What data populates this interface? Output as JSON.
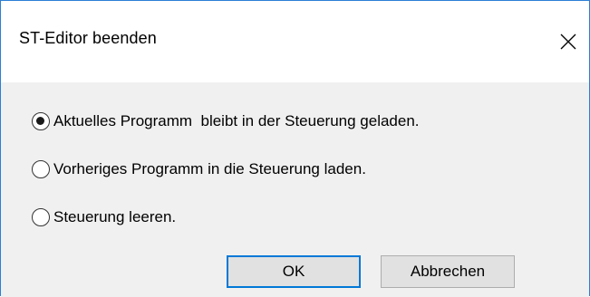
{
  "dialog": {
    "title": "ST-Editor beenden",
    "close_icon": "close-icon"
  },
  "options": [
    {
      "label": "Aktuelles Programm  bleibt in der Steuerung geladen.",
      "selected": true
    },
    {
      "label": "Vorheriges Programm in die Steuerung laden.",
      "selected": false
    },
    {
      "label": "Steuerung leeren.",
      "selected": false
    }
  ],
  "buttons": {
    "ok_label": "OK",
    "cancel_label": "Abbrechen"
  },
  "colors": {
    "accent": "#0078d7",
    "window_border": "#2b7fd6",
    "content_bg": "#f0f0f0"
  }
}
